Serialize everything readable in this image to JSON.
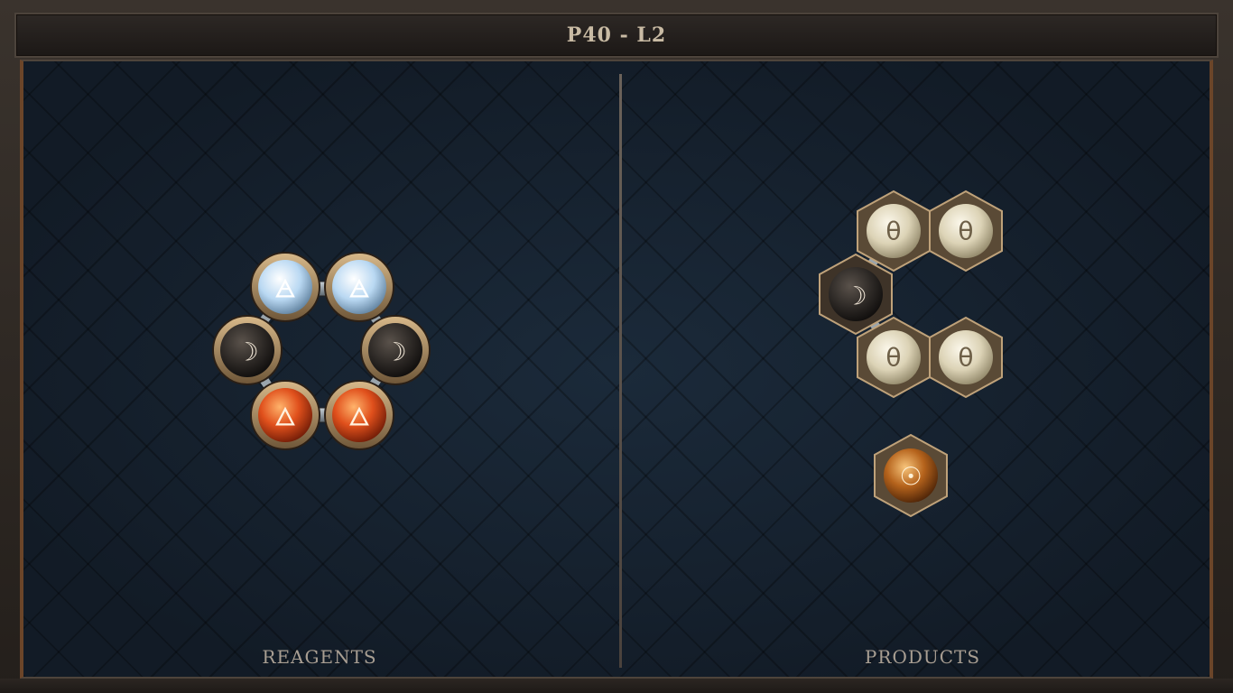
{
  "title": "P40 - L2",
  "panels": {
    "left_label": "REAGENTS",
    "right_label": "PRODUCTS"
  },
  "reagent_molecule": {
    "atoms": [
      {
        "element": "air",
        "symbol": "🜁",
        "icon": "air-triangle-icon",
        "color": "#cfe6f7"
      },
      {
        "element": "air",
        "symbol": "🜁",
        "icon": "air-triangle-icon",
        "color": "#cfe6f7"
      },
      {
        "element": "salt",
        "symbol": "☽",
        "icon": "moon-icon",
        "color": "#2b2724"
      },
      {
        "element": "salt",
        "symbol": "☽",
        "icon": "moon-icon",
        "color": "#2b2724"
      },
      {
        "element": "fire",
        "symbol": "🜂",
        "icon": "fire-triangle-icon",
        "color": "#e0501c"
      },
      {
        "element": "fire",
        "symbol": "🜂",
        "icon": "fire-triangle-icon",
        "color": "#e0501c"
      }
    ]
  },
  "product_molecules": [
    {
      "atoms": [
        {
          "element": "quicksilver",
          "symbol": "θ",
          "icon": "theta-icon",
          "color": "#e3dcc4"
        },
        {
          "element": "quicksilver",
          "symbol": "θ",
          "icon": "theta-icon",
          "color": "#e3dcc4"
        },
        {
          "element": "salt",
          "symbol": "☽",
          "icon": "moon-icon",
          "color": "#2b2724"
        },
        {
          "element": "quicksilver",
          "symbol": "θ",
          "icon": "theta-icon",
          "color": "#e3dcc4"
        },
        {
          "element": "quicksilver",
          "symbol": "θ",
          "icon": "theta-icon",
          "color": "#e3dcc4"
        }
      ]
    },
    {
      "atoms": [
        {
          "element": "gold",
          "symbol": "☉",
          "icon": "sun-icon",
          "color": "#b5631c"
        }
      ]
    }
  ]
}
